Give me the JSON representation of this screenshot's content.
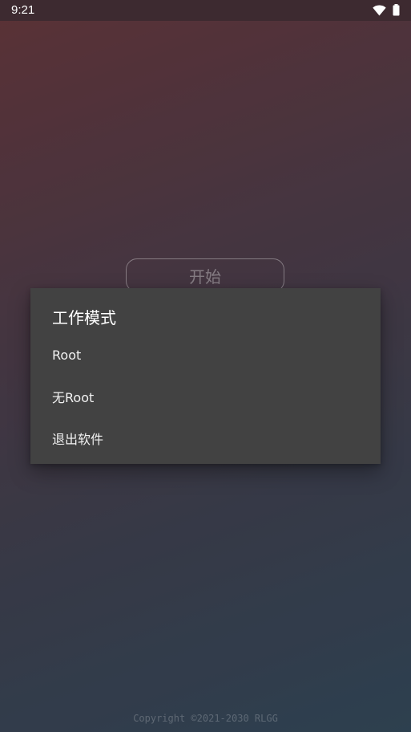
{
  "status_bar": {
    "time": "9:21",
    "icons": [
      "wifi-icon",
      "battery-icon"
    ]
  },
  "main": {
    "start_label": "开始",
    "copyright": "Copyright ©2021-2030 RLGG"
  },
  "dialog": {
    "title": "工作模式",
    "options": [
      {
        "label": "Root"
      },
      {
        "label": "无Root"
      },
      {
        "label": "退出软件"
      }
    ]
  },
  "colors": {
    "dialog_bg": "#424242",
    "status_bar_bg": "#3d2a30",
    "gradient_top": "#743f45",
    "gradient_bottom": "#3a5266"
  }
}
